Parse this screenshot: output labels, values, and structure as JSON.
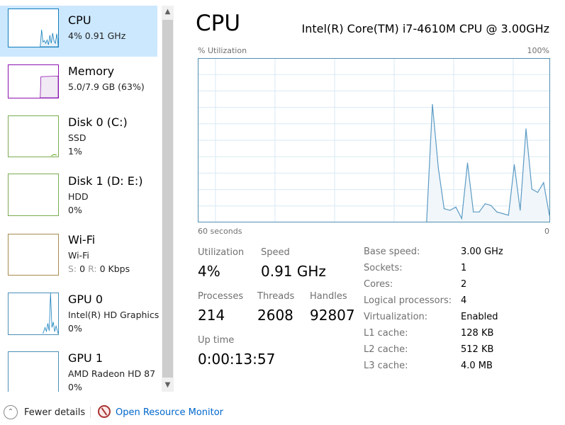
{
  "sidebar": {
    "items": [
      {
        "title": "CPU",
        "line1": "4% 0.91 GHz",
        "line2": "",
        "color": "#117dbb",
        "selected": true
      },
      {
        "title": "Memory",
        "line1": "5.0/7.9 GB (63%)",
        "line2": "",
        "color": "#8b12ae"
      },
      {
        "title": "Disk 0 (C:)",
        "line1": "SSD",
        "line2": "1%",
        "color": "#4da60c"
      },
      {
        "title": "Disk 1 (D: E:)",
        "line1": "HDD",
        "line2": "0%",
        "color": "#4da60c"
      },
      {
        "title": "Wi-Fi",
        "line1": "Wi-Fi",
        "line2_s": "S:",
        "line2_sv": "0",
        "line2_r": "R:",
        "line2_rv": "0 Kbps",
        "color": "#a74f01"
      },
      {
        "title": "GPU 0",
        "line1": "Intel(R) HD Graphics",
        "line2": "0%",
        "color": "#117dbb"
      },
      {
        "title": "GPU 1",
        "line1": "AMD Radeon HD 87",
        "line2": "0%",
        "color": "#117dbb"
      }
    ],
    "scroll_up": "^",
    "scroll_down": "v"
  },
  "header": {
    "title": "CPU",
    "model": "Intel(R) Core(TM) i7-4610M CPU @ 3.00GHz"
  },
  "chart_data": {
    "type": "area",
    "ylabel": "% Utilization",
    "ymax_label": "100%",
    "xlabel_left": "60 seconds",
    "xlabel_right": "0",
    "ylim": [
      0,
      100
    ],
    "xlim": [
      -60,
      0
    ],
    "grid": true,
    "color": "#117dbb",
    "x": [
      -21,
      -20,
      -19,
      -18,
      -17,
      -16,
      -15,
      -14,
      -13,
      -12,
      -11,
      -10,
      -9,
      -8,
      -7,
      -6,
      -5,
      -4,
      -3,
      -2,
      -1,
      0
    ],
    "values": [
      0,
      72,
      33,
      8,
      7,
      9,
      2,
      36,
      6,
      6,
      11,
      10,
      6,
      5,
      4,
      35,
      7,
      57,
      20,
      18,
      24,
      4
    ]
  },
  "stats": {
    "utilization": {
      "label": "Utilization",
      "value": "4%"
    },
    "speed": {
      "label": "Speed",
      "value": "0.91 GHz"
    },
    "processes": {
      "label": "Processes",
      "value": "214"
    },
    "threads": {
      "label": "Threads",
      "value": "2608"
    },
    "handles": {
      "label": "Handles",
      "value": "92807"
    },
    "uptime": {
      "label": "Up time",
      "value": "0:00:13:57"
    }
  },
  "specs": [
    {
      "k": "Base speed:",
      "v": "3.00 GHz"
    },
    {
      "k": "Sockets:",
      "v": "1"
    },
    {
      "k": "Cores:",
      "v": "2"
    },
    {
      "k": "Logical processors:",
      "v": "4"
    },
    {
      "k": "Virtualization:",
      "v": "Enabled"
    },
    {
      "k": "L1 cache:",
      "v": "128 KB"
    },
    {
      "k": "L2 cache:",
      "v": "512 KB"
    },
    {
      "k": "L3 cache:",
      "v": "4.0 MB"
    }
  ],
  "footer": {
    "fewer_details": "Fewer details",
    "open_monitor": "Open Resource Monitor",
    "link_color": "#0066cc"
  }
}
